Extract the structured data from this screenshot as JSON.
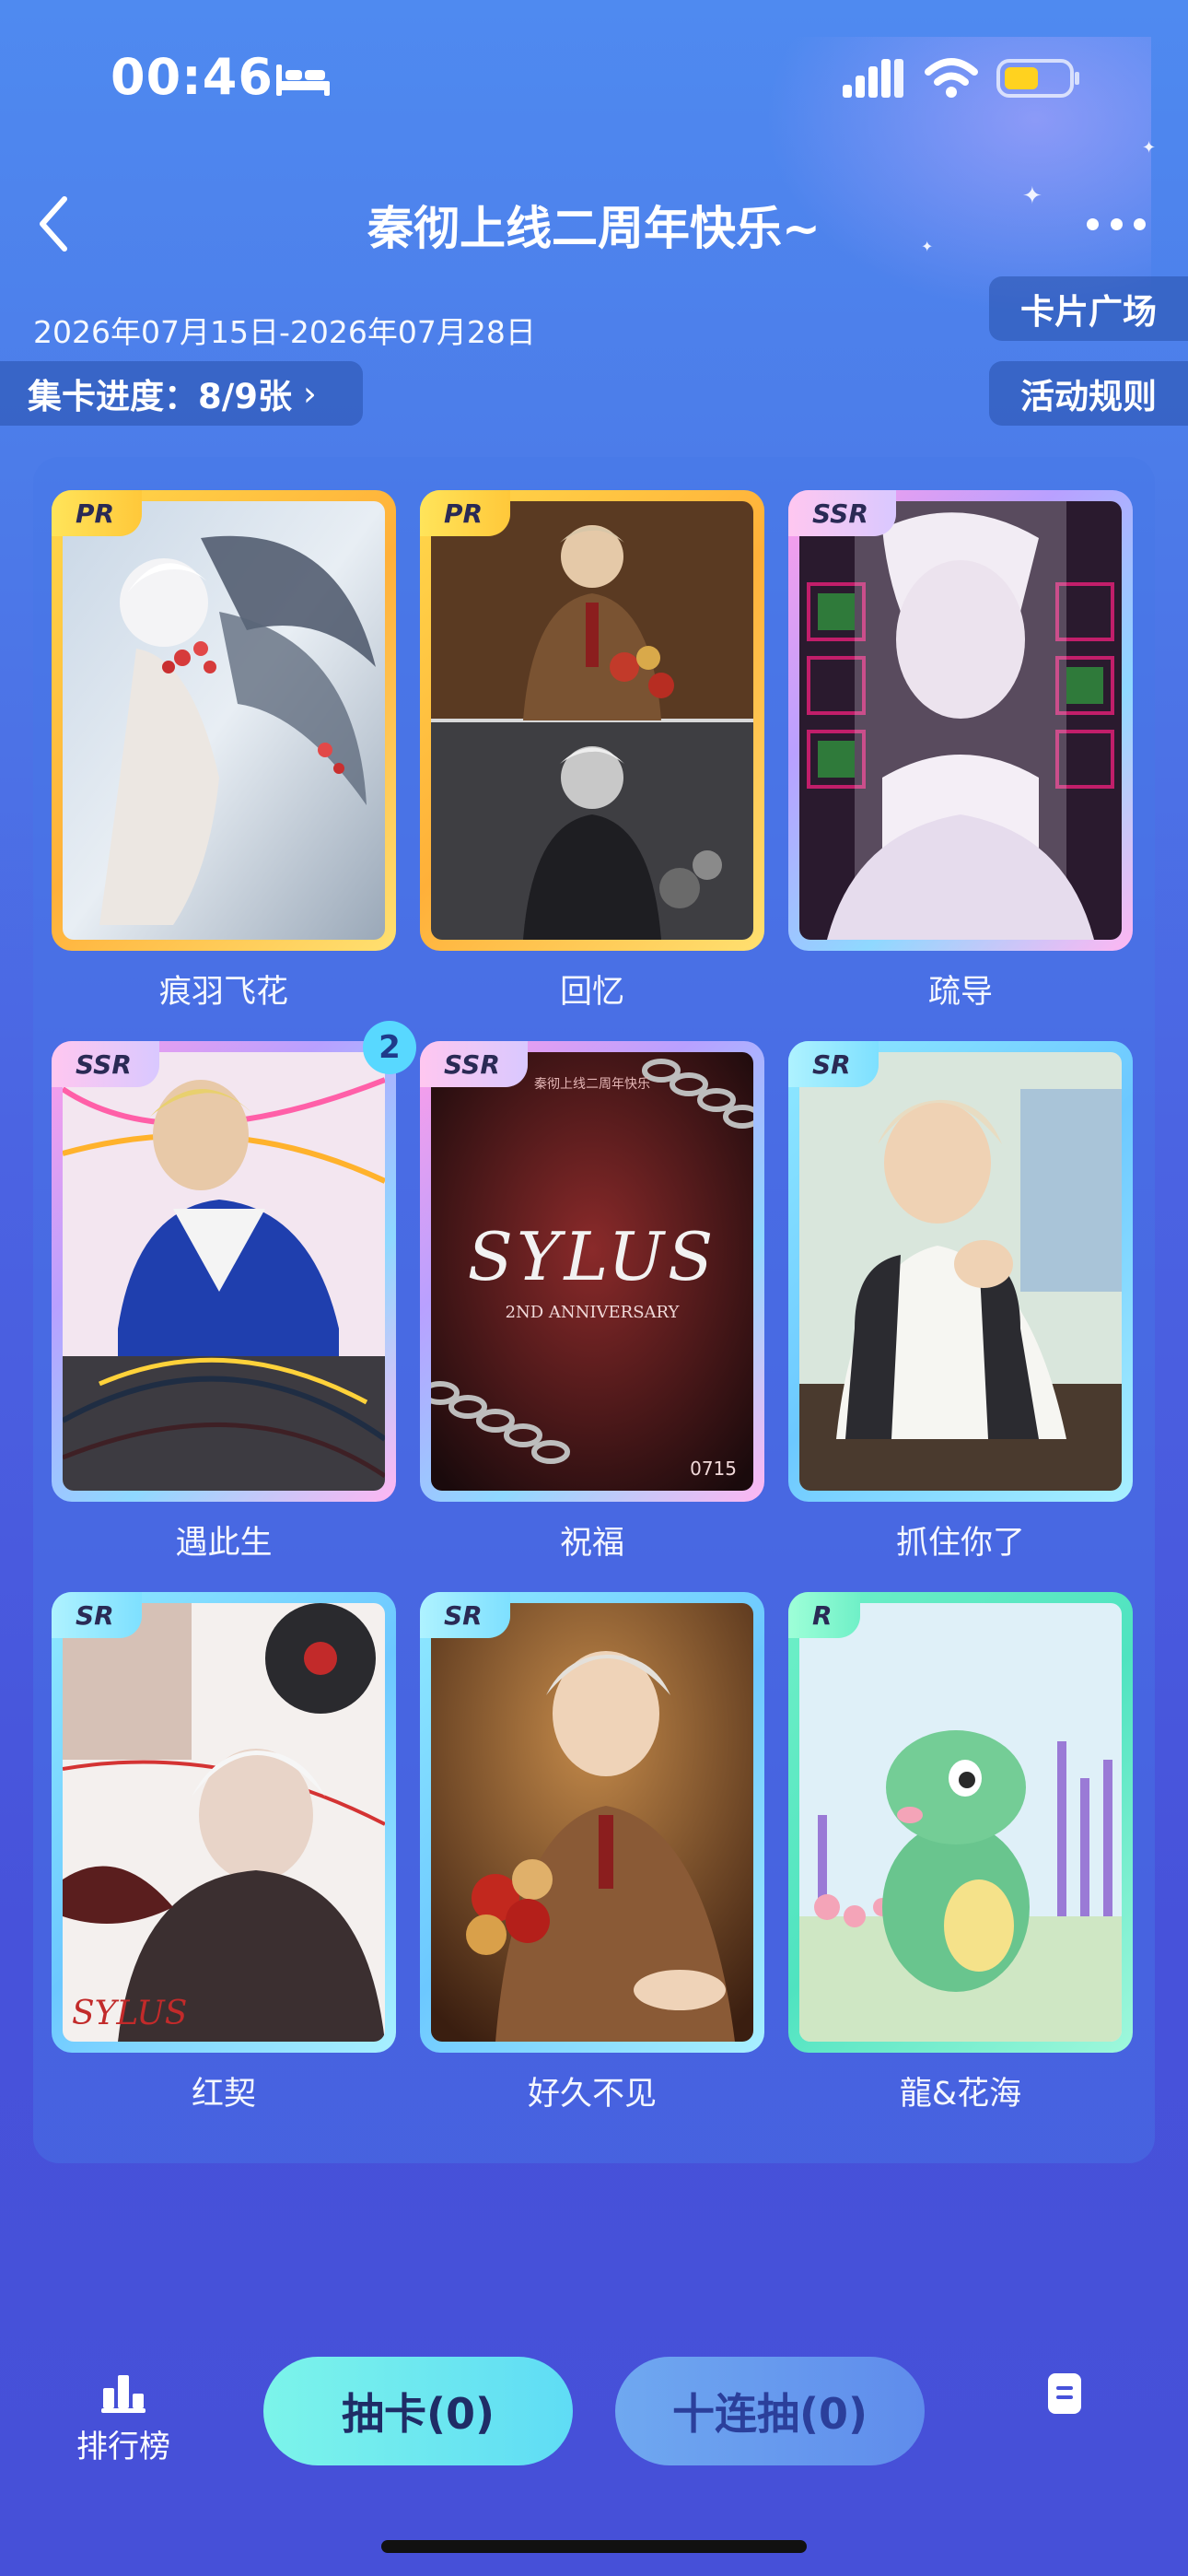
{
  "status_bar": {
    "time": "00:46"
  },
  "header": {
    "title": "秦彻上线二周年快乐~"
  },
  "event": {
    "date_range": "2026年07月15日-2026年07月28日",
    "progress_label": "集卡进度：8/9张",
    "progress_chevron": "›",
    "card_plaza": "卡片广场",
    "rules": "活动规则"
  },
  "cards": [
    {
      "rarity": "PR",
      "name": "痕羽飞花"
    },
    {
      "rarity": "PR",
      "name": "回忆"
    },
    {
      "rarity": "SSR",
      "name": "疏导"
    },
    {
      "rarity": "SSR",
      "name": "遇此生",
      "count": "2"
    },
    {
      "rarity": "SSR",
      "name": "祝福"
    },
    {
      "rarity": "SR",
      "name": "抓住你了"
    },
    {
      "rarity": "SR",
      "name": "红契"
    },
    {
      "rarity": "SR",
      "name": "好久不见"
    },
    {
      "rarity": "R",
      "name": "龍&花海"
    }
  ],
  "card_art_text": {
    "blessing_top": "秦彻上线二周年快乐",
    "blessing_big": "SYLUS",
    "blessing_sub": "2ND ANNIVERSARY",
    "blessing_num": "0715",
    "red_contract_script": "SYLUS"
  },
  "bottom_bar": {
    "ranking": "排行榜",
    "draw": "抽卡(0)",
    "draw10": "十连抽(0)"
  },
  "colors": {
    "accent_cyan": "#5fdcf5",
    "pr_gold": "#ffd84a",
    "ssr_pink": "#ff9ee8",
    "sr_blue": "#8fe9ff",
    "r_green": "#6ff0c7"
  }
}
